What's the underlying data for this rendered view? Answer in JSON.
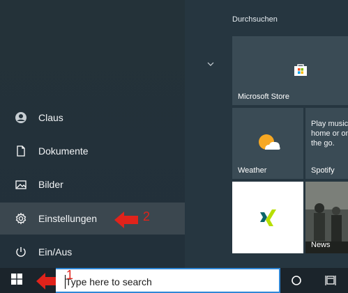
{
  "start_menu": {
    "rail_items": [
      {
        "label": "Claus",
        "icon": "user-avatar-icon"
      },
      {
        "label": "Dokumente",
        "icon": "document-icon"
      },
      {
        "label": "Bilder",
        "icon": "pictures-icon"
      },
      {
        "label": "Einstellungen",
        "icon": "gear-icon",
        "selected": true
      },
      {
        "label": "Ein/Aus",
        "icon": "power-icon"
      }
    ],
    "tiles": {
      "group_header": "Durchsuchen",
      "store": {
        "label": "Microsoft Store"
      },
      "weather": {
        "label": "Weather"
      },
      "spotify": {
        "label": "Spotify",
        "desc": "Play music at home or on the go."
      },
      "xing": {
        "label": ""
      },
      "news": {
        "label": "News"
      }
    }
  },
  "taskbar": {
    "search_placeholder": "Type here to search"
  },
  "annotations": {
    "step1": "1",
    "step2": "2",
    "color": "#e0231b"
  }
}
